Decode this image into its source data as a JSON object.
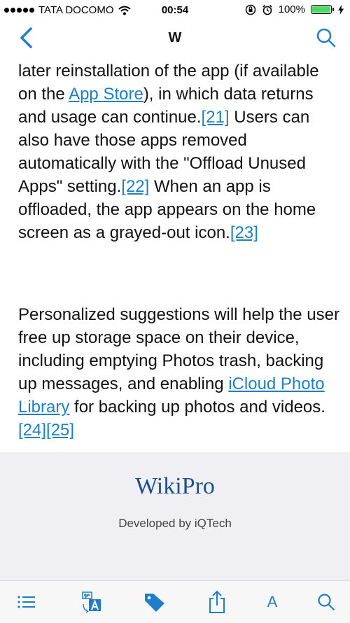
{
  "status_bar": {
    "carrier": "TATA DOCOMO",
    "time": "00:54",
    "battery": "100%",
    "battery_level": 1.0
  },
  "nav": {
    "title": "W"
  },
  "article": {
    "p1": {
      "t1": "later reinstallation of the app (if available on the ",
      "link_app_store": "App Store",
      "t2": "), in which data returns and usage can continue.",
      "ref21": "[21]",
      "t3": " Users can also have those apps removed automatically with the \"Offload Unused Apps\" setting.",
      "ref22": "[22]",
      "t4": " When an app is offloaded, the app appears on the home screen as a grayed-out icon.",
      "ref23": "[23]"
    },
    "p2": {
      "t1": "Personalized suggestions will help the user free up storage space on their device, including emptying Photos trash, backing up messages, and enabling ",
      "link_icloud": "iCloud Photo Library",
      "t2": " for backing up photos and videos.",
      "ref24": "[24]",
      "ref25": "[25]"
    }
  },
  "footer": {
    "logo": "WikiPro",
    "subtitle": "Developed by iQTech"
  },
  "tab_bar": {
    "font_label": "A"
  },
  "colors": {
    "accent": "#1f7fc6",
    "logo": "#1c4f8e",
    "footer_bg": "#efeff4"
  }
}
